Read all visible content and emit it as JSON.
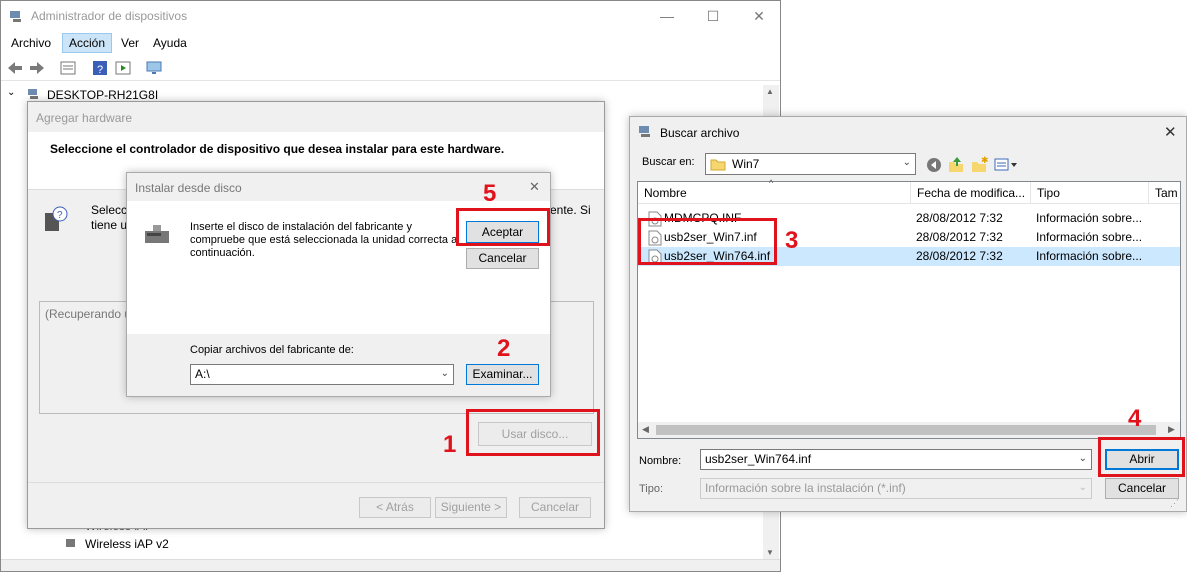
{
  "device_manager": {
    "title": "Administrador de dispositivos",
    "menu": [
      "Archivo",
      "Acción",
      "Ver",
      "Ayuda"
    ],
    "tree_root": "DESKTOP-RH21G8I",
    "tree_items_bottom": [
      "Wireless iAP",
      "Wireless iAP v2"
    ],
    "controls": {
      "minimize": "—",
      "maximize": "☐",
      "close": "✕"
    }
  },
  "add_hardware": {
    "title": "Agregar hardware",
    "heading": "Seleccione el controlador de dispositivo que desea instalar para este hardware.",
    "text_left_1": "Selecci",
    "text_left_2": "tiene u",
    "text_right": "ente. Si",
    "list_loading": "(Recuperando u",
    "use_disk_button": "Usar disco...",
    "back_button": "< Atrás",
    "next_button": "Siguiente >",
    "cancel_button": "Cancelar"
  },
  "install_from_disk": {
    "title": "Instalar desde disco",
    "message": "Inserte el disco de instalación del fabricante y compruebe que está seleccionada la unidad correcta a continuación.",
    "ok_button": "Aceptar",
    "cancel_button": "Cancelar",
    "copy_label": "Copiar archivos del fabricante de:",
    "path_value": "A:\\",
    "browse_button": "Examinar...",
    "close": "✕"
  },
  "browse_file": {
    "title": "Buscar archivo",
    "look_in_label": "Buscar en:",
    "look_in_value": "Win7",
    "columns": [
      "Nombre",
      "Fecha de modifica...",
      "Tipo",
      "Tam"
    ],
    "files": [
      {
        "name": "MDMCPQ.INF",
        "date": "28/08/2012 7:32",
        "type": "Información sobre..."
      },
      {
        "name": "usb2ser_Win7.inf",
        "date": "28/08/2012 7:32",
        "type": "Información sobre..."
      },
      {
        "name": "usb2ser_Win764.inf",
        "date": "28/08/2012 7:32",
        "type": "Información sobre..."
      }
    ],
    "selected_index": 2,
    "filename_label": "Nombre:",
    "filename_value": "usb2ser_Win764.inf",
    "type_label": "Tipo:",
    "type_value": "Información sobre la instalación (*.inf)",
    "open_button": "Abrir",
    "cancel_button": "Cancelar",
    "close": "✕"
  },
  "annotations": {
    "step1": "1",
    "step2": "2",
    "step3": "3",
    "step4": "4",
    "step5": "5",
    "color": "#e0131c"
  }
}
